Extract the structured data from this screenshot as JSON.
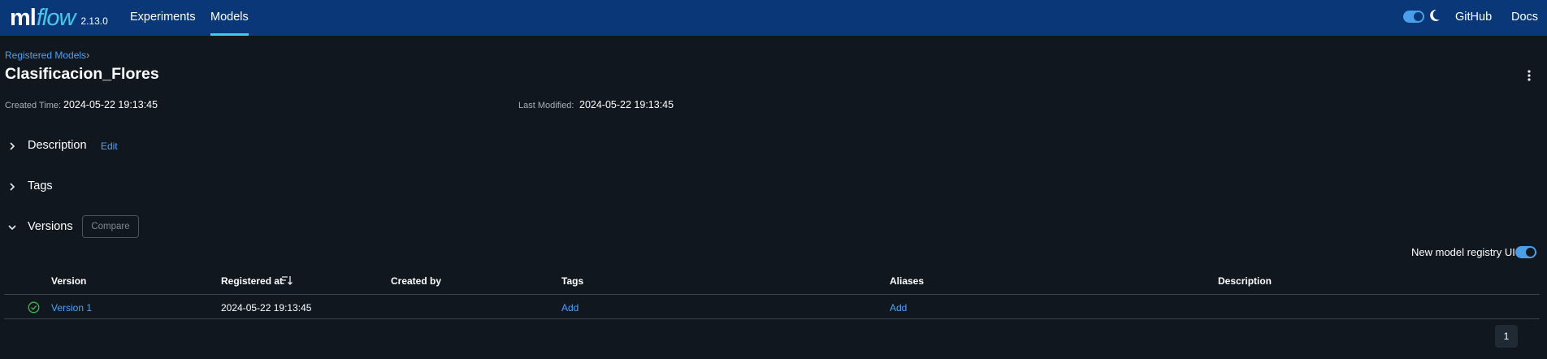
{
  "app": {
    "logo_ml": "ml",
    "logo_flow": "flow",
    "version": "2.13.0",
    "accent_color": "#43c9ed",
    "header_color": "#0a3778",
    "link_color": "#4ea1f3"
  },
  "nav": {
    "experiments": "Experiments",
    "models": "Models",
    "github": "GitHub",
    "docs": "Docs"
  },
  "breadcrumb": {
    "label": "Registered Models",
    "separator": "›"
  },
  "model": {
    "name": "Clasificacion_Flores",
    "created_label": "Created Time:",
    "created_value": "2024-05-22 19:13:45",
    "modified_label": "Last Modified:",
    "modified_value": "2024-05-22 19:13:45"
  },
  "sections": {
    "description": "Description",
    "description_edit": "Edit",
    "tags": "Tags",
    "versions": "Versions",
    "compare_button": "Compare"
  },
  "registry_toggle": {
    "label": "New model registry UI",
    "enabled": true
  },
  "table": {
    "columns": {
      "version": "Version",
      "registered_at": "Registered at",
      "created_by": "Created by",
      "tags": "Tags",
      "aliases": "Aliases",
      "description": "Description"
    },
    "rows": [
      {
        "status_icon": "check-circle-icon",
        "version": "Version 1",
        "registered_at": "2024-05-22 19:13:45",
        "created_by": "",
        "tags": "Add",
        "aliases": "Add",
        "description": ""
      }
    ]
  },
  "pagination": {
    "current_page": "1"
  }
}
